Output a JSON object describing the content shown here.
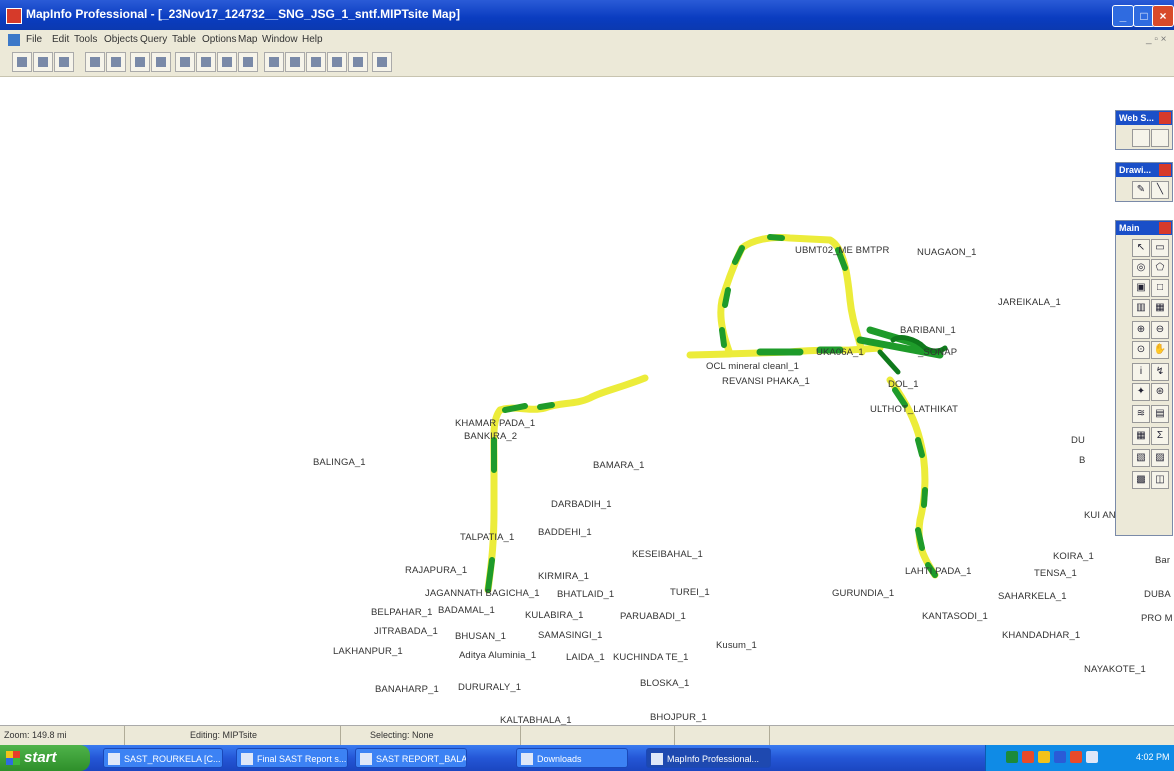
{
  "window": {
    "title": "MapInfo Professional - [_23Nov17_124732__SNG_JSG_1_sntf.MIPTsite Map]"
  },
  "menu": [
    "File",
    "Edit",
    "Tools",
    "Objects",
    "Query",
    "Table",
    "Options",
    "Map",
    "Window",
    "Help"
  ],
  "palettes": {
    "web": "Web S...",
    "drawing": "Drawi...",
    "main": "Main"
  },
  "map_labels": [
    "UBMT02_ME BMTPR",
    "NUAGAON_1",
    "JAREIKALA_1",
    "BARIBANI_1",
    "UKA06A_1",
    "_SONAP",
    "OCL mineral cleanl_1",
    "REVANSI PHAKA_1",
    "DOL_1",
    "ULTHOT_LATHIKAT",
    "KHAMAR PADA_1",
    "BANKIRA_2",
    "BALINGA_1",
    "BAMARA_1",
    "DARBADIH_1",
    "TALPATIA_1",
    "BADDEHI_1",
    "KESEIBAHAL_1",
    "RAJAPURA_1",
    "KIRMIRA_1",
    "JAGANNATH BAGICHA_1",
    "BHATLAID_1",
    "TUREI_1",
    "GURUNDIA_1",
    "LAHTI PADA_1",
    "TENSA_1",
    "KOIRA_1",
    "SAHARKELA_1",
    "DUBA",
    "PRO M",
    "BELPAHAR_1",
    "BADAMAL_1",
    "KULABIRA_1",
    "PARUABADI_1",
    "KANTASODI_1",
    "KHANDADHAR_1",
    "JITRABADA_1",
    "BHUSAN_1",
    "SAMASINGI_1",
    "Kusum_1",
    "LAKHANPUR_1",
    "Aditya Aluminia_1",
    "LAIDA_1",
    "KUCHINDA TE_1",
    "BLOSKA_1",
    "NAYAKOTE_1",
    "BANAHARP_1",
    "DURURALY_1",
    "BHOJPUR_1",
    "KALTABHALA_1",
    "DU",
    "B",
    "KUI AN",
    "Bar"
  ],
  "status": {
    "zoom": "Zoom: 149.8 mi",
    "editing": "Editing: MIPTsite",
    "selecting": "Selecting: None"
  },
  "taskbar": {
    "start": "start",
    "tasks": [
      "SAST_ROURKELA [C...",
      "Final SAST Report s...",
      "SAST REPORT_BALA...",
      "Downloads",
      "MapInfo Professional..."
    ],
    "clock": "4:02 PM"
  },
  "colors": {
    "route_yellow": "#ecec3a",
    "route_green": "#1e9b2a",
    "titlebar": "#0a3cc0",
    "taskbar": "#2456d6"
  }
}
